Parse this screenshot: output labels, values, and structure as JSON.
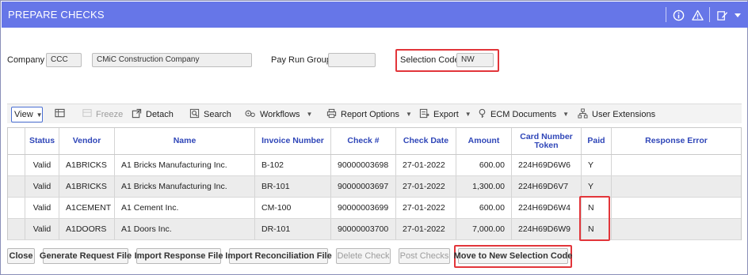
{
  "window": {
    "title": "PREPARE CHECKS"
  },
  "header_icons": [
    "info-icon",
    "warning-icon",
    "edit-icon",
    "caret-down-icon"
  ],
  "form": {
    "company_label": "Company",
    "company_code": "CCC",
    "company_name": "CMiC Construction Company",
    "pay_run_group_label": "Pay Run Group",
    "pay_run_group_value": "",
    "selection_code_label": "Selection Code",
    "selection_code_value": "NW"
  },
  "toolbar": {
    "view_label": "View",
    "freeze_label": "Freeze",
    "detach_label": "Detach",
    "search_label": "Search",
    "workflows_label": "Workflows",
    "report_options_label": "Report Options",
    "export_label": "Export",
    "ecm_documents_label": "ECM Documents",
    "user_extensions_label": "User Extensions"
  },
  "table": {
    "columns": [
      "Status",
      "Vendor",
      "Name",
      "Invoice Number",
      "Check #",
      "Check Date",
      "Amount",
      "Card Number Token",
      "Paid",
      "Response Error"
    ],
    "rows": [
      [
        "Valid",
        "A1BRICKS",
        "A1 Bricks Manufacturing Inc.",
        "B-102",
        "90000003698",
        "27-01-2022",
        "600.00",
        "224H69D6W6",
        "Y",
        ""
      ],
      [
        "Valid",
        "A1BRICKS",
        "A1 Bricks Manufacturing Inc.",
        "BR-101",
        "90000003697",
        "27-01-2022",
        "1,300.00",
        "224H69D6V7",
        "Y",
        ""
      ],
      [
        "Valid",
        "A1CEMENT",
        "A1 Cement Inc.",
        "CM-100",
        "90000003699",
        "27-01-2022",
        "600.00",
        "224H69D6W4",
        "N",
        ""
      ],
      [
        "Valid",
        "A1DOORS",
        "A1 Doors Inc.",
        "DR-101",
        "90000003700",
        "27-01-2022",
        "7,000.00",
        "224H69D6W9",
        "N",
        ""
      ]
    ]
  },
  "buttons": {
    "close": "Close",
    "generate_request_file": "Generate Request File",
    "import_response_file": "Import Response File",
    "import_reconciliation_file": "Import Reconciliation File",
    "delete_check": "Delete Check",
    "post_checks": "Post Checks",
    "move_to_new_selection_code": "Move to New Selection Code"
  },
  "colors": {
    "title_bar": "#6676e8",
    "column_header_text": "#2f46b8",
    "highlight_box": "#e2353a"
  }
}
